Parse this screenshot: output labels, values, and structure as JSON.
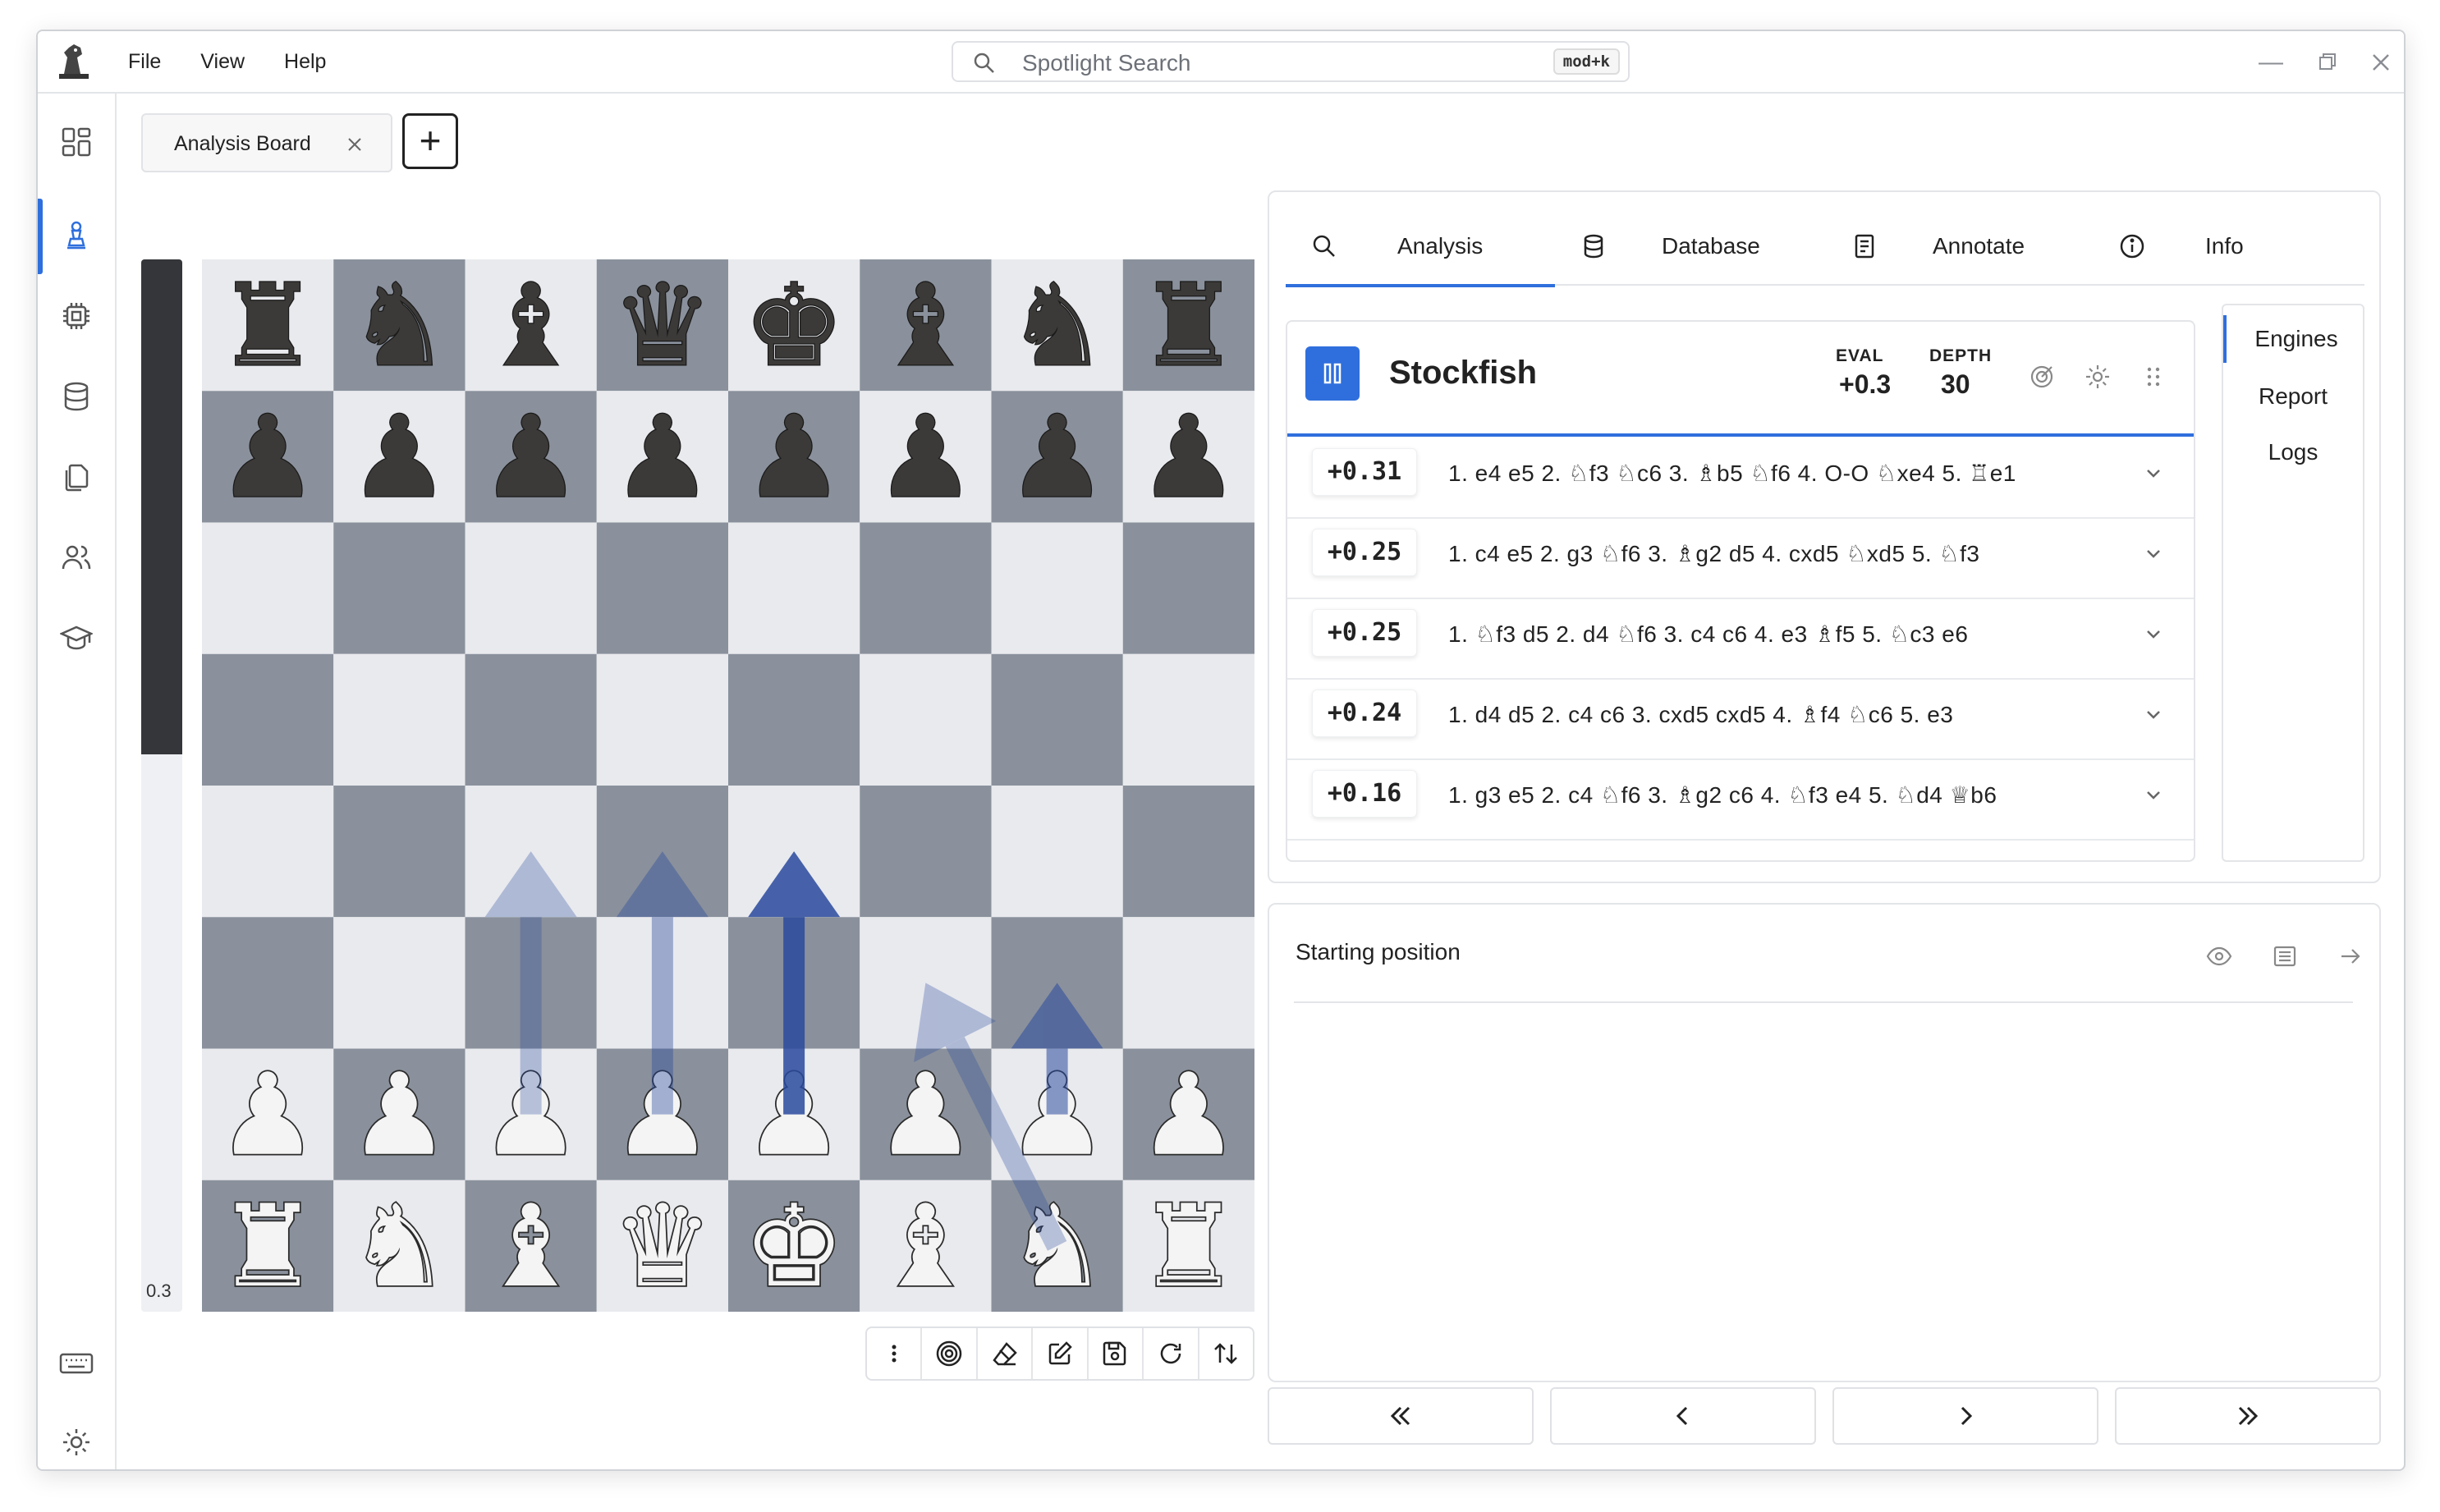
{
  "menu": {
    "file": "File",
    "view": "View",
    "help": "Help"
  },
  "search": {
    "placeholder": "Spotlight Search",
    "shortcut": "mod+k"
  },
  "tabs": {
    "doc_tab_label": "Analysis Board"
  },
  "eval_bar": {
    "label": "0.3",
    "white_fraction": 0.53
  },
  "panel": {
    "tabs": [
      {
        "label": "Analysis",
        "icon": "search-icon",
        "active": true
      },
      {
        "label": "Database",
        "icon": "database-icon",
        "active": false
      },
      {
        "label": "Annotate",
        "icon": "notes-icon",
        "active": false
      },
      {
        "label": "Info",
        "icon": "info-icon",
        "active": false
      }
    ],
    "engine": {
      "name": "Stockfish",
      "eval_label": "EVAL",
      "eval_value": "+0.3",
      "depth_label": "DEPTH",
      "depth_value": "30",
      "lines": [
        {
          "score": "+0.31",
          "moves": "1. e4  e5 2. ♘f3  ♘c6 3. ♗b5  ♘f6 4. O-O  ♘xe4 5. ♖e1"
        },
        {
          "score": "+0.25",
          "moves": "1. c4  e5 2. g3  ♘f6 3. ♗g2  d5 4. cxd5  ♘xd5 5. ♘f3"
        },
        {
          "score": "+0.25",
          "moves": "1. ♘f3  d5 2. d4  ♘f6 3. c4  c6 4. e3  ♗f5 5. ♘c3  e6"
        },
        {
          "score": "+0.24",
          "moves": "1. d4  d5 2. c4  c6 3. cxd5  cxd5 4. ♗f4  ♘c6 5. e3"
        },
        {
          "score": "+0.16",
          "moves": "1. g3  e5 2. c4  ♘f6 3. ♗g2  c6 4. ♘f3  e4 5. ♘d4  ♕b6"
        }
      ]
    },
    "side_tabs": [
      {
        "label": "Engines",
        "active": true
      },
      {
        "label": "Report",
        "active": false
      },
      {
        "label": "Logs",
        "active": false
      }
    ]
  },
  "moves_panel": {
    "title": "Starting position"
  },
  "board": {
    "light": "#e9eaee",
    "dark": "#8a919c",
    "ranks": [
      [
        "bR",
        "bN",
        "bB",
        "bQ",
        "bK",
        "bB",
        "bN",
        "bR"
      ],
      [
        "bP",
        "bP",
        "bP",
        "bP",
        "bP",
        "bP",
        "bP",
        "bP"
      ],
      [
        "",
        "",
        "",
        "",
        "",
        "",
        "",
        ""
      ],
      [
        "",
        "",
        "",
        "",
        "",
        "",
        "",
        ""
      ],
      [
        "",
        "",
        "",
        "",
        "",
        "",
        "",
        ""
      ],
      [
        "",
        "",
        "",
        "",
        "",
        "",
        "",
        ""
      ],
      [
        "wP",
        "wP",
        "wP",
        "wP",
        "wP",
        "wP",
        "wP",
        "wP"
      ],
      [
        "wR",
        "wN",
        "wB",
        "wQ",
        "wK",
        "wB",
        "wN",
        "wR"
      ]
    ],
    "arrows": [
      {
        "from": "c2",
        "to": "c4",
        "strength": "faint"
      },
      {
        "from": "d2",
        "to": "d4",
        "strength": "light"
      },
      {
        "from": "e2",
        "to": "e4",
        "strength": "strong"
      },
      {
        "from": "g1",
        "to": "f3",
        "strength": "faint"
      },
      {
        "from": "g2",
        "to": "g3",
        "strength": "medium"
      }
    ]
  },
  "colors": {
    "accent": "#2f6fdd"
  }
}
